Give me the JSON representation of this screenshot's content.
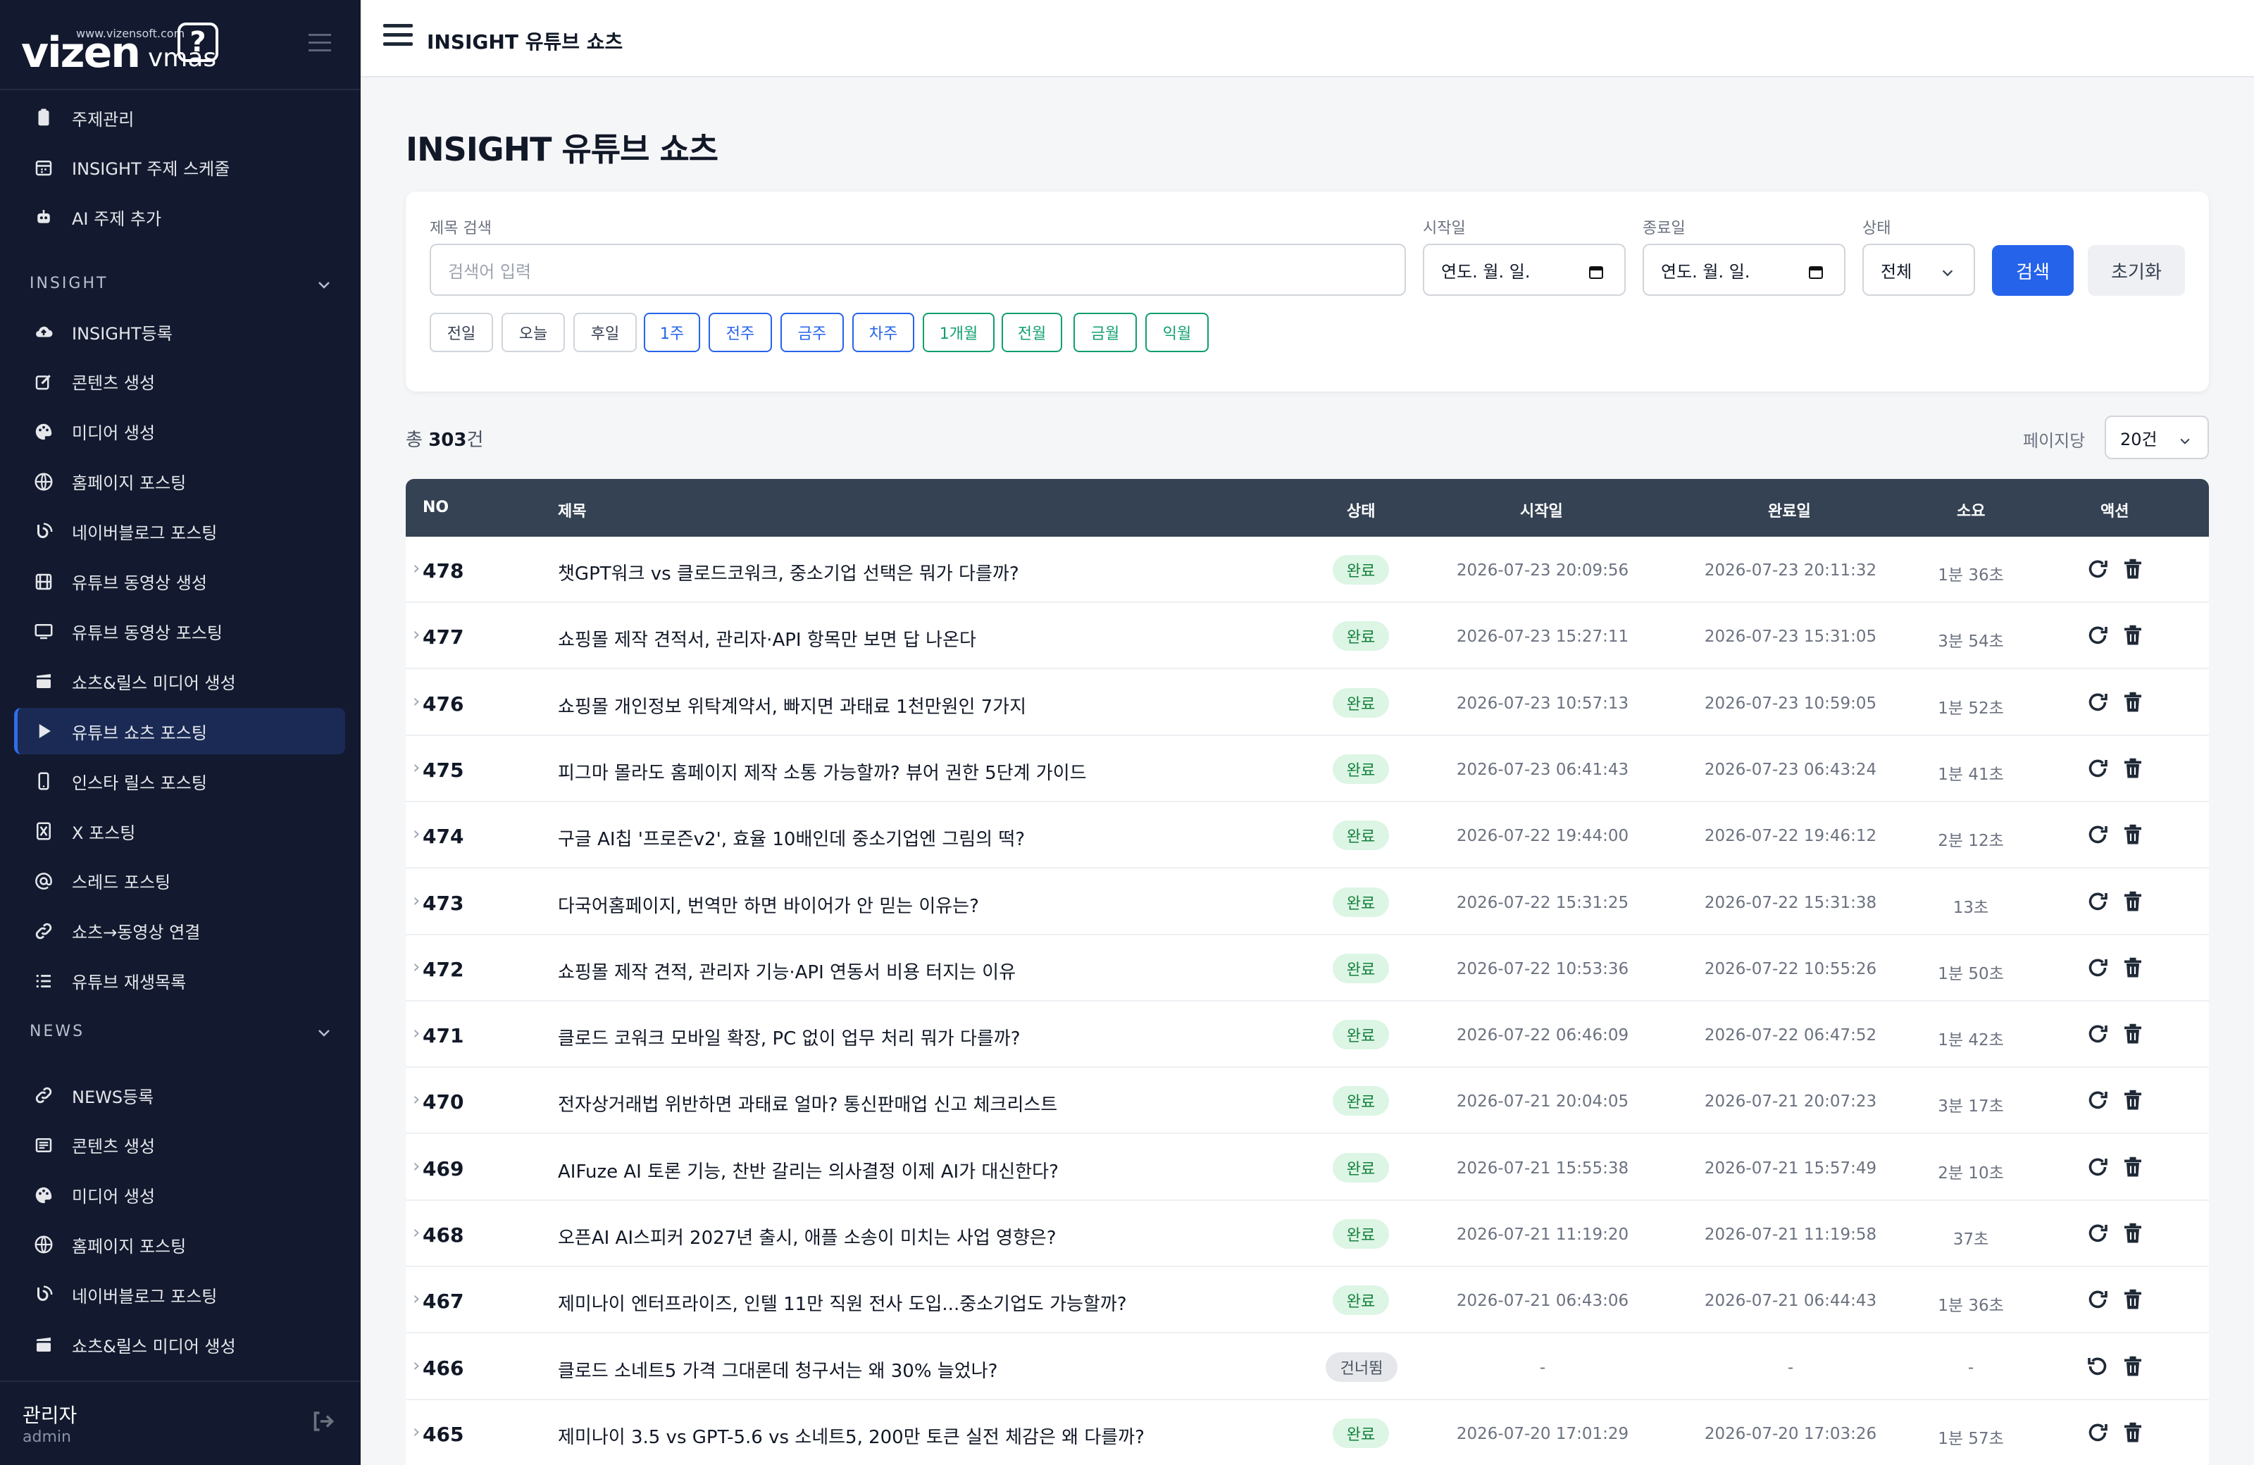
{
  "brand": {
    "url": "www.vizensoft.com",
    "name": "vizen",
    "sub": "vmas",
    "mark": "?"
  },
  "sidebar": {
    "top_items": [
      {
        "label": "주제관리",
        "icon": "clipboard-icon"
      },
      {
        "label": "INSIGHT 주제 스케줄",
        "icon": "calendar-icon"
      },
      {
        "label": "AI 주제 추가",
        "icon": "robot-icon"
      }
    ],
    "insight_section": "INSIGHT",
    "insight_items": [
      {
        "label": "INSIGHT등록",
        "icon": "cloud-upload-icon"
      },
      {
        "label": "콘텐츠 생성",
        "icon": "edit-icon"
      },
      {
        "label": "미디어 생성",
        "icon": "palette-icon"
      },
      {
        "label": "홈페이지 포스팅",
        "icon": "globe-icon"
      },
      {
        "label": "네이버블로그 포스팅",
        "icon": "blog-icon"
      },
      {
        "label": "유튜브 동영상 생성",
        "icon": "film-icon"
      },
      {
        "label": "유튜브 동영상 포스팅",
        "icon": "monitor-icon"
      },
      {
        "label": "쇼츠&릴스 미디어 생성",
        "icon": "clapperboard-icon"
      },
      {
        "label": "유튜브 쇼츠 포스팅",
        "icon": "play-icon"
      },
      {
        "label": "인스타 릴스 포스팅",
        "icon": "mobile-icon"
      },
      {
        "label": "X 포스팅",
        "icon": "x-icon"
      },
      {
        "label": "스레드 포스팅",
        "icon": "at-icon"
      },
      {
        "label": "쇼츠→동영상 연결",
        "icon": "link-icon"
      },
      {
        "label": "유튜브 재생목록",
        "icon": "list-icon"
      }
    ],
    "news_section": "NEWS",
    "news_items": [
      {
        "label": "NEWS등록",
        "icon": "link-icon"
      },
      {
        "label": "콘텐츠 생성",
        "icon": "newspaper-icon"
      },
      {
        "label": "미디어 생성",
        "icon": "palette-icon"
      },
      {
        "label": "홈페이지 포스팅",
        "icon": "globe-icon"
      },
      {
        "label": "네이버블로그 포스팅",
        "icon": "blog-icon"
      },
      {
        "label": "쇼츠&릴스 미디어 생성",
        "icon": "clapperboard-icon"
      }
    ],
    "user": {
      "name": "관리자",
      "role": "admin"
    }
  },
  "topbar": {
    "title": "INSIGHT 유튜브 쇼츠"
  },
  "page": {
    "title": "INSIGHT 유튜브 쇼츠"
  },
  "search": {
    "title_label": "제목 검색",
    "title_placeholder": "검색어 입력",
    "start_label": "시작일",
    "start_value": "연도. 월. 일.",
    "end_label": "종료일",
    "end_value": "연도. 월. 일.",
    "status_label": "상태",
    "status_value": "전체",
    "search_button": "검색",
    "reset_button": "초기화",
    "quick": [
      "전일",
      "오늘",
      "후일",
      "1주",
      "전주",
      "금주",
      "차주",
      "1개월",
      "전월",
      "금월",
      "익월"
    ]
  },
  "summary": {
    "total_prefix": "총 ",
    "total_count": "303",
    "total_suffix": "건",
    "per_page_label": "페이지당",
    "per_page_value": "20건"
  },
  "table": {
    "headers": [
      "NO",
      "제목",
      "상태",
      "시작일",
      "완료일",
      "소요",
      "액션"
    ],
    "rows": [
      {
        "no": "478",
        "title": "챗GPT워크 vs 클로드코워크, 중소기업 선택은 뭐가 다를까?",
        "status": "완료",
        "start": "2026-07-23 20:09:56",
        "end": "2026-07-23 20:11:32",
        "duration": "1분 36초"
      },
      {
        "no": "477",
        "title": "쇼핑몰 제작 견적서, 관리자·API 항목만 보면 답 나온다",
        "status": "완료",
        "start": "2026-07-23 15:27:11",
        "end": "2026-07-23 15:31:05",
        "duration": "3분 54초"
      },
      {
        "no": "476",
        "title": "쇼핑몰 개인정보 위탁계약서, 빠지면 과태료 1천만원인 7가지",
        "status": "완료",
        "start": "2026-07-23 10:57:13",
        "end": "2026-07-23 10:59:05",
        "duration": "1분 52초"
      },
      {
        "no": "475",
        "title": "피그마 몰라도 홈페이지 제작 소통 가능할까? 뷰어 권한 5단계 가이드",
        "status": "완료",
        "start": "2026-07-23 06:41:43",
        "end": "2026-07-23 06:43:24",
        "duration": "1분 41초"
      },
      {
        "no": "474",
        "title": "구글 AI칩 '프로즌v2', 효율 10배인데 중소기업엔 그림의 떡?",
        "status": "완료",
        "start": "2026-07-22 19:44:00",
        "end": "2026-07-22 19:46:12",
        "duration": "2분 12초"
      },
      {
        "no": "473",
        "title": "다국어홈페이지, 번역만 하면 바이어가 안 믿는 이유는?",
        "status": "완료",
        "start": "2026-07-22 15:31:25",
        "end": "2026-07-22 15:31:38",
        "duration": "13초"
      },
      {
        "no": "472",
        "title": "쇼핑몰 제작 견적, 관리자 기능·API 연동서 비용 터지는 이유",
        "status": "완료",
        "start": "2026-07-22 10:53:36",
        "end": "2026-07-22 10:55:26",
        "duration": "1분 50초"
      },
      {
        "no": "471",
        "title": "클로드 코워크 모바일 확장, PC 없이 업무 처리 뭐가 다를까?",
        "status": "완료",
        "start": "2026-07-22 06:46:09",
        "end": "2026-07-22 06:47:52",
        "duration": "1분 42초"
      },
      {
        "no": "470",
        "title": "전자상거래법 위반하면 과태료 얼마? 통신판매업 신고 체크리스트",
        "status": "완료",
        "start": "2026-07-21 20:04:05",
        "end": "2026-07-21 20:07:23",
        "duration": "3분 17초"
      },
      {
        "no": "469",
        "title": "AIFuze AI 토론 기능, 찬반 갈리는 의사결정 이제 AI가 대신한다?",
        "status": "완료",
        "start": "2026-07-21 15:55:38",
        "end": "2026-07-21 15:57:49",
        "duration": "2분 10초"
      },
      {
        "no": "468",
        "title": "오픈AI AI스피커 2027년 출시, 애플 소송이 미치는 사업 영향은?",
        "status": "완료",
        "start": "2026-07-21 11:19:20",
        "end": "2026-07-21 11:19:58",
        "duration": "37초"
      },
      {
        "no": "467",
        "title": "제미나이 엔터프라이즈, 인텔 11만 직원 전사 도입...중소기업도 가능할까?",
        "status": "완료",
        "start": "2026-07-21 06:43:06",
        "end": "2026-07-21 06:44:43",
        "duration": "1분 36초"
      },
      {
        "no": "466",
        "title": "클로드 소네트5 가격 그대론데 청구서는 왜 30% 늘었나?",
        "status": "건너뜀",
        "start": "-",
        "end": "-",
        "duration": "-"
      },
      {
        "no": "465",
        "title": "제미나이 3.5 vs GPT-5.6 vs 소네트5, 200만 토큰 실전 체감은 왜 다를까?",
        "status": "완료",
        "start": "2026-07-20 17:01:29",
        "end": "2026-07-20 17:03:26",
        "duration": "1분 57초"
      }
    ]
  },
  "colors": {
    "sidebar_bg": "#131a2f",
    "accent": "#2563eb",
    "success": "#15803d",
    "table_header": "#354253"
  }
}
